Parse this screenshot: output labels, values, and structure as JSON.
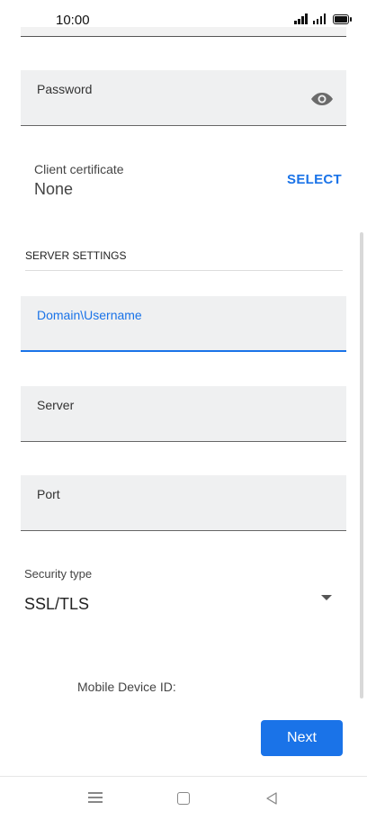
{
  "status_bar": {
    "time": "10:00",
    "icons": [
      "signal-icon",
      "signal-icon",
      "battery-icon"
    ]
  },
  "password_field": {
    "label": "Password",
    "value": "",
    "visibility_icon": "eye-icon"
  },
  "client_certificate": {
    "label": "Client certificate",
    "value": "None",
    "select_label": "SELECT"
  },
  "server_settings": {
    "section_title": "SERVER SETTINGS",
    "domain_username": {
      "label": "Domain\\Username",
      "value": ""
    },
    "server": {
      "label": "Server",
      "value": ""
    },
    "port": {
      "label": "Port",
      "value": ""
    }
  },
  "security_type": {
    "label": "Security type",
    "selected": "SSL/TLS"
  },
  "device_id_label": "Mobile Device ID:",
  "next_label": "Next",
  "nav_bar": {
    "icons": [
      "menu-icon",
      "home-icon",
      "back-icon"
    ]
  },
  "colors": {
    "accent": "#1a73e8",
    "field_bg": "#eff0f1"
  }
}
